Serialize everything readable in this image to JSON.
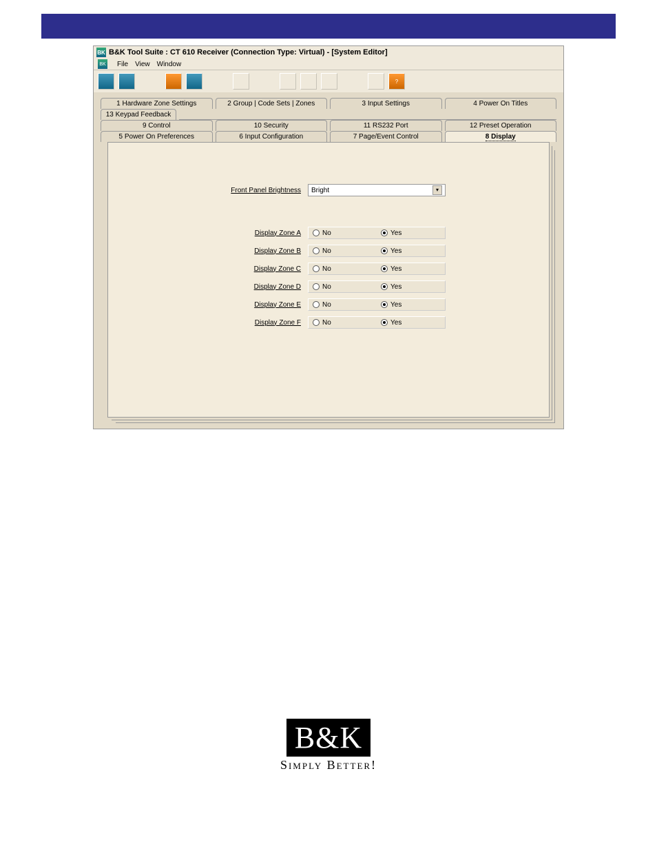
{
  "window": {
    "title": "B&K Tool Suite : CT 610 Receiver (Connection Type: Virtual) - [System Editor]",
    "icon_text": "BK"
  },
  "menu": {
    "file": "File",
    "view": "View",
    "window": "Window"
  },
  "tabs_row1": [
    "1   Hardware Zone Settings",
    "2   Group | Code Sets | Zones",
    "3   Input Settings",
    "4   Power On Titles"
  ],
  "tabs_row2_left": "13 Keypad Feedback",
  "tabs_row3": [
    "9   Control",
    "10   Security",
    "11   RS232 Port",
    "12   Preset Operation"
  ],
  "tabs_row4": [
    "5   Power On Preferences",
    "6   Input Configuration",
    "7   Page/Event Control"
  ],
  "tabs_active": "8   Display",
  "form": {
    "brightness_label": "Front Panel Brightness",
    "brightness_value": "Bright",
    "zones": [
      {
        "label": "Display Zone A",
        "no": "No",
        "yes": "Yes",
        "selected": "yes"
      },
      {
        "label": "Display Zone B",
        "no": "No",
        "yes": "Yes",
        "selected": "yes"
      },
      {
        "label": "Display Zone C",
        "no": "No",
        "yes": "Yes",
        "selected": "yes"
      },
      {
        "label": "Display Zone D",
        "no": "No",
        "yes": "Yes",
        "selected": "yes"
      },
      {
        "label": "Display Zone E",
        "no": "No",
        "yes": "Yes",
        "selected": "yes"
      },
      {
        "label": "Display Zone F",
        "no": "No",
        "yes": "Yes",
        "selected": "yes"
      }
    ]
  },
  "logo": {
    "name": "B&K",
    "tagline": "Simply Better!"
  }
}
